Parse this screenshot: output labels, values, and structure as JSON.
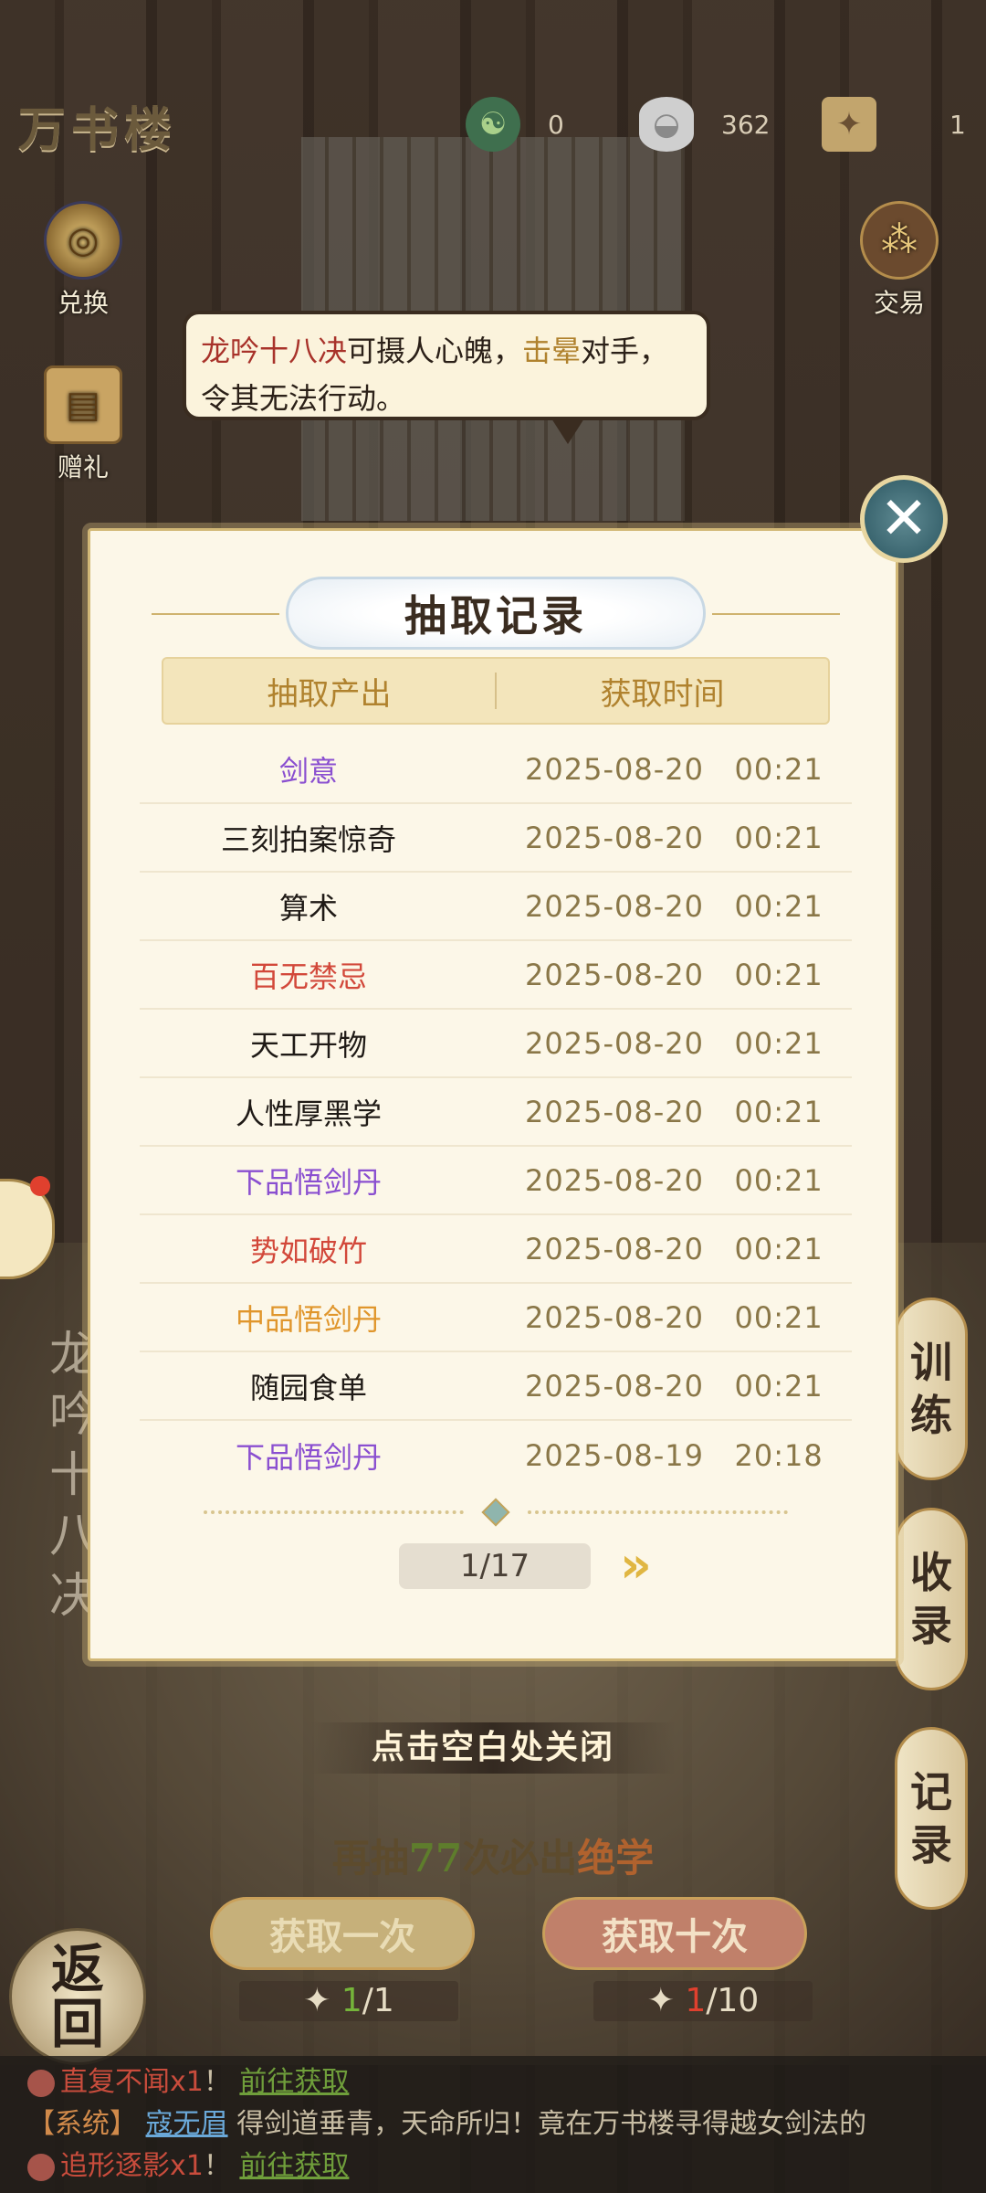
{
  "app": {
    "title": "万书楼"
  },
  "currencies": [
    {
      "icon": "jade-token-icon",
      "value": "0"
    },
    {
      "icon": "silver-ingot-icon",
      "value": "362"
    },
    {
      "icon": "draw-ticket-icon",
      "value": "1"
    }
  ],
  "side_buttons": {
    "exchange": "兑换",
    "gift": "赠礼",
    "trade": "交易"
  },
  "speech": {
    "part1": "龙吟十八决",
    "part2": "可摄人心魄，",
    "part3": "击晕",
    "part4": "对手，令其无法行动。"
  },
  "left_title": "龙吟十八决",
  "modal": {
    "title": "抽取记录",
    "columns": [
      "抽取产出",
      "获取时间"
    ],
    "rows": [
      {
        "name": "剑意",
        "time": "2025-08-20   00:21",
        "rarity_color": "#8a4fd0"
      },
      {
        "name": "三刻拍案惊奇",
        "time": "2025-08-20   00:21",
        "rarity_color": "#1f1a16"
      },
      {
        "name": "算术",
        "time": "2025-08-20   00:21",
        "rarity_color": "#1f1a16"
      },
      {
        "name": "百无禁忌",
        "time": "2025-08-20   00:21",
        "rarity_color": "#d2483a"
      },
      {
        "name": "天工开物",
        "time": "2025-08-20   00:21",
        "rarity_color": "#1f1a16"
      },
      {
        "name": "人性厚黑学",
        "time": "2025-08-20   00:21",
        "rarity_color": "#1f1a16"
      },
      {
        "name": "下品悟剑丹",
        "time": "2025-08-20   00:21",
        "rarity_color": "#8a4fd0"
      },
      {
        "name": "势如破竹",
        "time": "2025-08-20   00:21",
        "rarity_color": "#d2483a"
      },
      {
        "name": "中品悟剑丹",
        "time": "2025-08-20   00:21",
        "rarity_color": "#e0962c"
      },
      {
        "name": "随园食单",
        "time": "2025-08-20   00:21",
        "rarity_color": "#1f1a16"
      },
      {
        "name": "下品悟剑丹",
        "time": "2025-08-19   20:18",
        "rarity_color": "#8a4fd0"
      }
    ],
    "page": "1/17"
  },
  "right_tabs": [
    "训练",
    "收录",
    "记录"
  ],
  "hint": "点击空白处关闭",
  "pity": {
    "pre": "再抽",
    "num": "77",
    "mid": "次必出",
    "end": "绝学"
  },
  "draw": {
    "once_label": "获取一次",
    "ten_label": "获取十次",
    "once_cost_have": "1",
    "once_cost_need": "/1",
    "ten_cost_have": "1",
    "ten_cost_need": "/10"
  },
  "back_label": "返回",
  "chat": {
    "line1": {
      "item": "直复不闻x1",
      "sep": "！",
      "link": "前往获取"
    },
    "line2": {
      "tag": "【系统】",
      "user": "寇无眉",
      "text": "得剑道垂青，天命所归！竟在万书楼寻得越女剑法的"
    },
    "line3": {
      "item": "追形逐影x1",
      "sep": "！",
      "link": "前往获取"
    }
  }
}
